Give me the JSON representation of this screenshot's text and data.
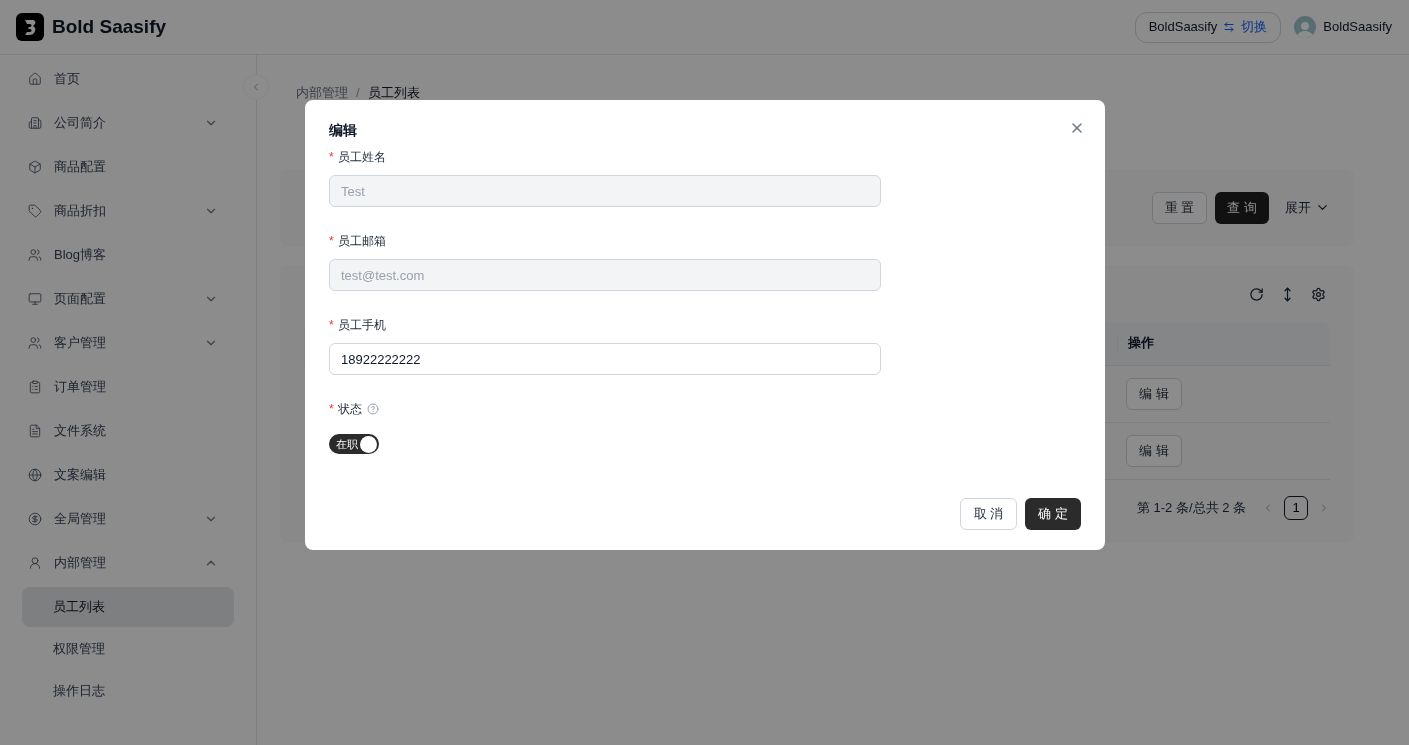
{
  "header": {
    "brand": "Bold Saasify",
    "tenant": {
      "name": "BoldSaasify",
      "switch_label": "切换"
    },
    "user": {
      "name": "BoldSaasify"
    }
  },
  "sidebar": {
    "items": [
      {
        "label": "首页",
        "selected": false
      },
      {
        "label": "公司简介",
        "selected": false,
        "expanded": false
      },
      {
        "label": "商品配置",
        "selected": false
      },
      {
        "label": "商品折扣",
        "selected": false,
        "expanded": false
      },
      {
        "label": "Blog博客",
        "selected": false
      },
      {
        "label": "页面配置",
        "selected": false,
        "expanded": false
      },
      {
        "label": "客户管理",
        "selected": false,
        "expanded": false
      },
      {
        "label": "订单管理",
        "selected": false
      },
      {
        "label": "文件系统",
        "selected": false
      },
      {
        "label": "文案编辑",
        "selected": false
      },
      {
        "label": "全局管理",
        "selected": false,
        "expanded": false
      },
      {
        "label": "内部管理",
        "selected": false,
        "expanded": true,
        "children": [
          {
            "label": "员工列表",
            "selected": true
          },
          {
            "label": "权限管理",
            "selected": false
          },
          {
            "label": "操作日志",
            "selected": false
          }
        ]
      }
    ]
  },
  "breadcrumb": {
    "items": [
      "内部管理",
      "员工列表"
    ],
    "separator": "/"
  },
  "search_bar": {
    "buttons": [
      {
        "label": "重 置",
        "kind": "default"
      },
      {
        "label": "查 询",
        "kind": "primary"
      }
    ],
    "expand": {
      "label": "展开",
      "expanded": false
    }
  },
  "table": {
    "columns": [
      "操作"
    ],
    "rows": [
      {
        "action": "编 辑"
      },
      {
        "action": "编 辑"
      }
    ],
    "pagination": {
      "summary": "第 1-2 条/总共 2 条",
      "pages": [
        {
          "label": "1",
          "selected": true
        }
      ]
    }
  },
  "dialog": {
    "title": "编辑",
    "fields": [
      {
        "kind": "input",
        "label": "员工姓名",
        "required_mark": "*",
        "value": "Test",
        "disabled": true
      },
      {
        "kind": "input",
        "label": "员工邮箱",
        "required_mark": "*",
        "value": "test@test.com",
        "disabled": true
      },
      {
        "kind": "input",
        "label": "员工手机",
        "required_mark": "*",
        "value": "18922222222",
        "disabled": false
      },
      {
        "kind": "switch",
        "label": "状态",
        "required_mark": "*",
        "help": true,
        "on": true,
        "on_label": "在职"
      }
    ],
    "buttons": [
      {
        "label": "取 消",
        "kind": "default"
      },
      {
        "label": "确 定",
        "kind": "primary"
      }
    ]
  }
}
